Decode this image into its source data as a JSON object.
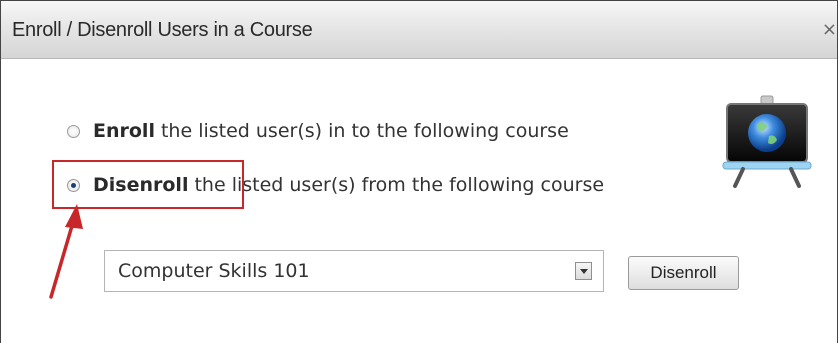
{
  "dialog": {
    "title": "Enroll / Disenroll Users in a Course",
    "close_symbol": "×"
  },
  "options": [
    {
      "bold": "Enroll",
      "rest": "the listed user(s) in to the following course",
      "checked": false
    },
    {
      "bold": "Disenroll",
      "rest": "the listed user(s) from the following course",
      "checked": true
    }
  ],
  "course_select": {
    "value": "Computer Skills 101"
  },
  "action_button": {
    "label": "Disenroll"
  },
  "icons": {
    "course_icon": "presentation-easel-globe-icon",
    "annotation_arrow": "red-arrow-icon"
  },
  "colors": {
    "annotation": "#c8272a"
  }
}
